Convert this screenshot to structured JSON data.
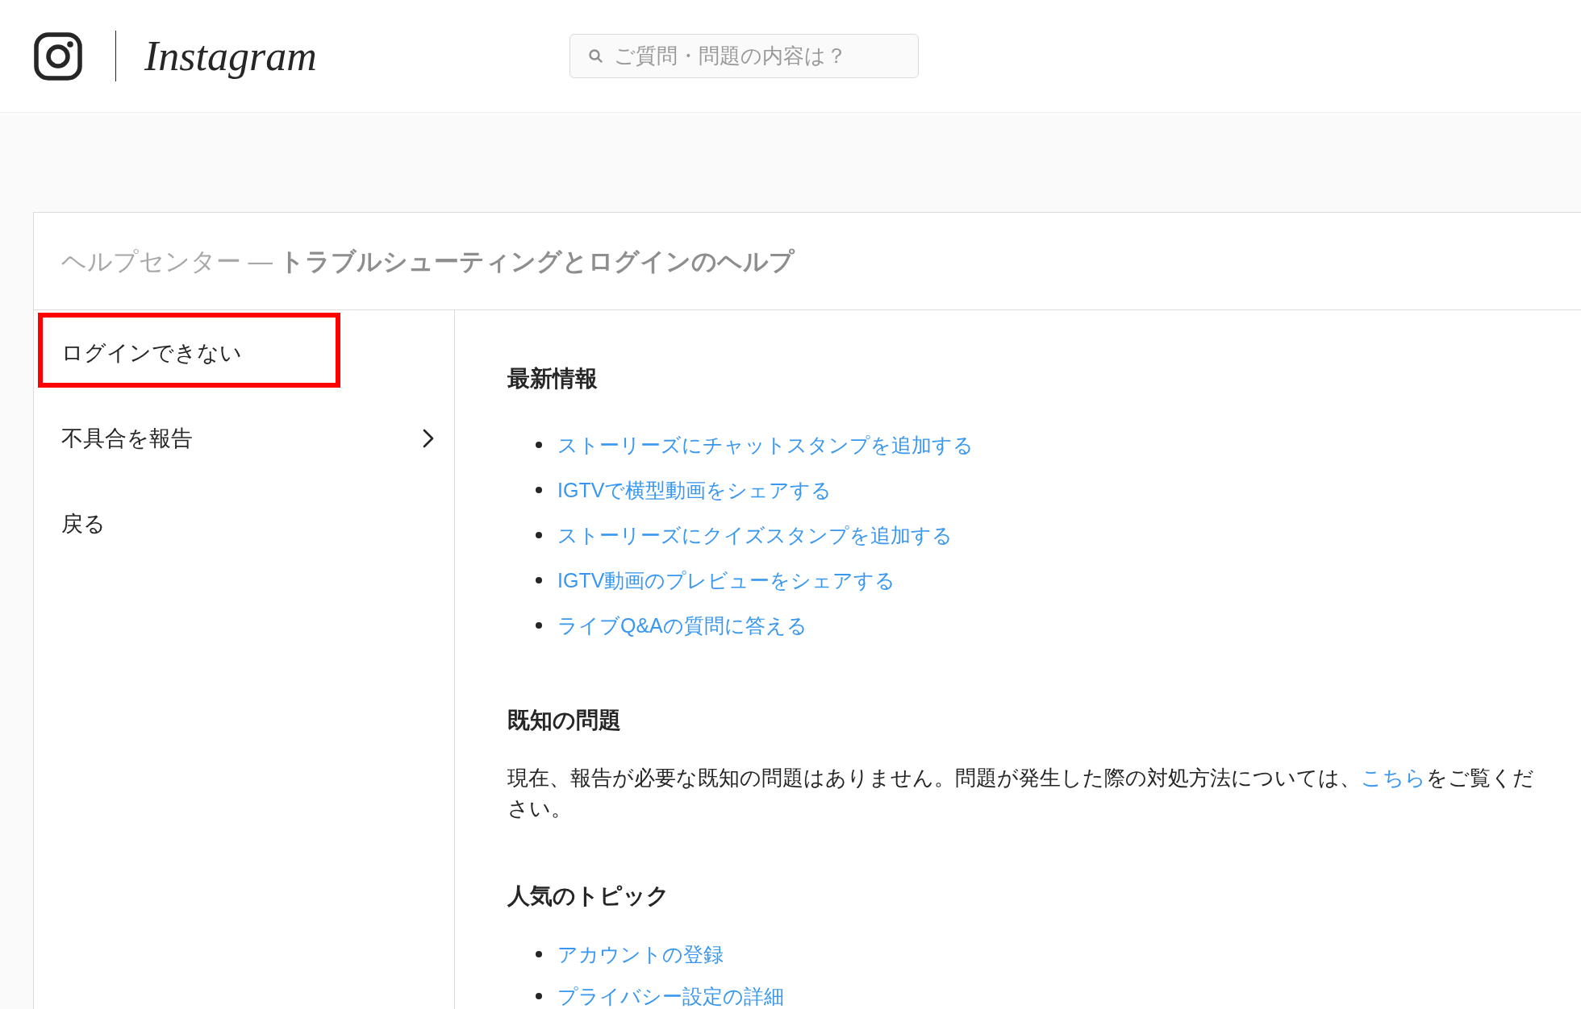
{
  "header": {
    "logo_text": "Instagram",
    "search": {
      "placeholder": "ご質問・問題の内容は？"
    }
  },
  "breadcrumb": "ヘルプセンター — **トラブルシューティングとログインのヘルプ**",
  "sidebar": {
    "items": [
      {
        "label": "ログインできない",
        "has_submenu": false,
        "highlighted": true
      },
      {
        "label": "不具合を報告",
        "has_submenu": true,
        "highlighted": false
      },
      {
        "label": "戻る",
        "has_submenu": false,
        "highlighted": false
      }
    ]
  },
  "sections": [
    {
      "kind": "links",
      "heading": "最新情報",
      "links": [
        "ストーリーズにチャットスタンプを追加する",
        "IGTVで横型動画をシェアする",
        "ストーリーズにクイズスタンプを追加する",
        "IGTV動画のプレビューをシェアする",
        "ライブQ&Aの質問に答える"
      ]
    },
    {
      "kind": "paragraph",
      "heading": "既知の問題",
      "text": {
        "before": "現在、報告が必要な既知の問題はありません。問題が発生した際の対処方法については、",
        "link": "こちら",
        "after": "をご覧ください。"
      }
    },
    {
      "kind": "links",
      "heading": "人気のトピック",
      "links": [
        "アカウントの登録",
        "プライバシー設定の詳細"
      ]
    }
  ]
}
